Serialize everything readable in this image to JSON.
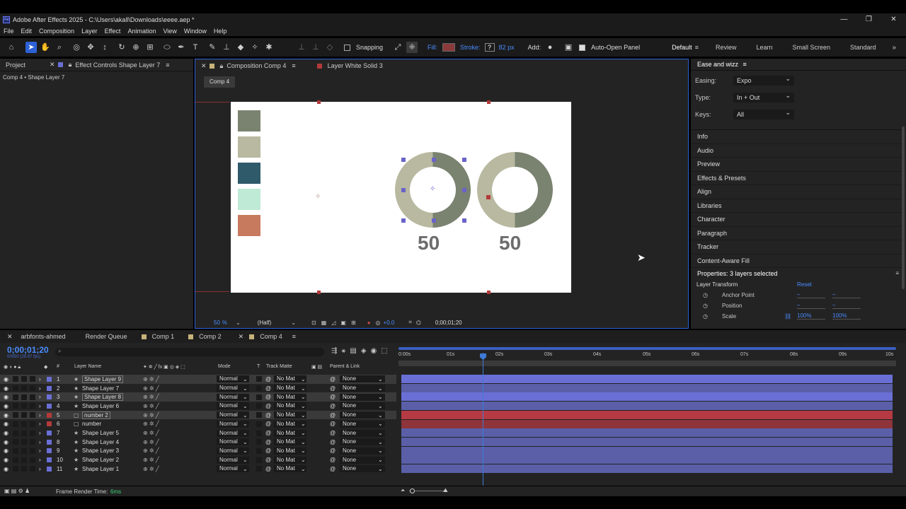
{
  "window": {
    "title": "Adobe After Effects 2025 - C:\\Users\\akall\\Downloads\\eeee.aep *",
    "app_icon": "Ae"
  },
  "menu": [
    "File",
    "Edit",
    "Composition",
    "Layer",
    "Effect",
    "Animation",
    "View",
    "Window",
    "Help"
  ],
  "toolbar": {
    "snapping": "Snapping",
    "fill": "Fill:",
    "stroke": "Stroke:",
    "stroke_q": "?",
    "stroke_px": "82 px",
    "add": "Add:",
    "auto_open": "Auto-Open Panel",
    "workspaces": [
      "Default",
      "Review",
      "Learn",
      "Small Screen",
      "Standard"
    ]
  },
  "left_panel": {
    "tab1": "Project",
    "tab2": "Effect Controls Shape Layer 7",
    "breadcrumb": "Comp 4 • Shape Layer 7"
  },
  "comp_panel": {
    "tab1": "Composition Comp 4",
    "tab2": "Layer White Solid 3",
    "comp_label": "Comp 4",
    "zoom": "50",
    "zoom_unit": "%",
    "resolution": "(Half)",
    "exposure": "+0.0",
    "timecode": "0;00;01;20",
    "numbers": [
      "50",
      "50"
    ]
  },
  "right_panel": {
    "title": "Ease and wizz",
    "easing_label": "Easing:",
    "easing_value": "Expo",
    "type_label": "Type:",
    "type_value": "In + Out",
    "keys_label": "Keys:",
    "keys_value": "All",
    "panels": [
      "Info",
      "Audio",
      "Preview",
      "Effects & Presets",
      "Align",
      "Libraries",
      "Character",
      "Paragraph",
      "Tracker",
      "Content-Aware Fill"
    ],
    "properties": "Properties: 3 layers selected",
    "layer_transform": "Layer Transform",
    "reset": "Reset",
    "anchor": "Anchor Point",
    "position": "Position",
    "scale": "Scale",
    "scale_x": "100%",
    "scale_y": "100%",
    "dash": "–"
  },
  "timeline": {
    "tabs": [
      "arbfonts-ahmed",
      "Render Queue",
      "Comp 1",
      "Comp 2",
      "Comp 4"
    ],
    "timecode": "0;00;01;20",
    "fps": "00050 (29.97 fps)",
    "headers": {
      "num": "#",
      "name": "Layer Name",
      "mode": "Mode",
      "t": "T",
      "matte": "Track Matte",
      "parent": "Parent & Link"
    },
    "ruler": [
      "0:00s",
      "01s",
      "02s",
      "03s",
      "04s",
      "05s",
      "06s",
      "07s",
      "08s",
      "09s",
      "10s"
    ],
    "layers": [
      {
        "num": "1",
        "name": "Shape Layer 9",
        "mode": "Normal",
        "matte": "No Mat",
        "parent": "None"
      },
      {
        "num": "2",
        "name": "Shape Layer 7",
        "mode": "Normal",
        "matte": "No Mat",
        "parent": "None"
      },
      {
        "num": "3",
        "name": "Shape Layer 8",
        "mode": "Normal",
        "matte": "No Mat",
        "parent": "None"
      },
      {
        "num": "4",
        "name": "Shape Layer 6",
        "mode": "Normal",
        "matte": "No Mat",
        "parent": "None"
      },
      {
        "num": "5",
        "name": "number 2",
        "mode": "Normal",
        "matte": "No Mat",
        "parent": "None"
      },
      {
        "num": "6",
        "name": "number",
        "mode": "Normal",
        "matte": "No Mat",
        "parent": "None"
      },
      {
        "num": "7",
        "name": "Shape Layer 5",
        "mode": "Normal",
        "matte": "No Mat",
        "parent": "None"
      },
      {
        "num": "8",
        "name": "Shape Layer 4",
        "mode": "Normal",
        "matte": "No Mat",
        "parent": "None"
      },
      {
        "num": "9",
        "name": "Shape Layer 3",
        "mode": "Normal",
        "matte": "No Mat",
        "parent": "None"
      },
      {
        "num": "10",
        "name": "Shape Layer 2",
        "mode": "Normal",
        "matte": "No Mat",
        "parent": "None"
      },
      {
        "num": "11",
        "name": "Shape Layer 1",
        "mode": "Normal",
        "matte": "No Mat",
        "parent": "None"
      }
    ]
  },
  "status": {
    "label": "Frame Render Time:",
    "value": "6ms"
  },
  "colors": {
    "accent": "#2d62d6",
    "swatch1": "#7a8270",
    "swatch2": "#b8b9a0",
    "swatch3": "#2f5a6a",
    "swatch4": "#bfead5",
    "swatch5": "#c87a5e",
    "shape_label": "#6a6fd6",
    "text_label": "#b33a3a"
  }
}
